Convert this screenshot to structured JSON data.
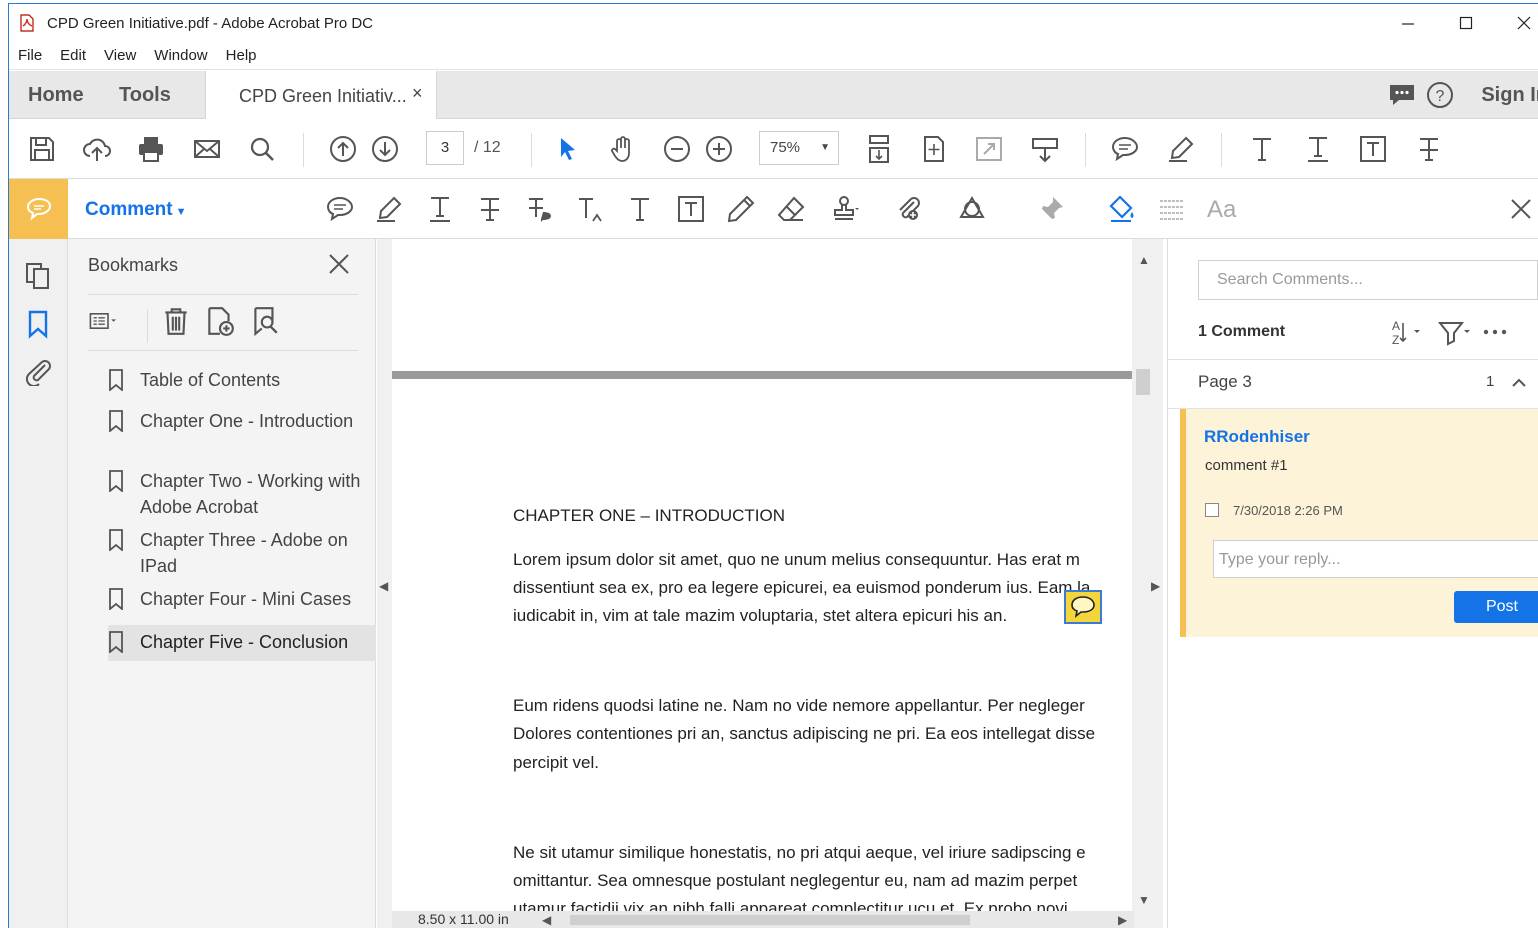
{
  "window": {
    "title": "CPD Green Initiative.pdf - Adobe Acrobat Pro DC",
    "accent_color": "#2b79d0"
  },
  "menu": [
    "File",
    "Edit",
    "View",
    "Window",
    "Help"
  ],
  "tabs": {
    "home": "Home",
    "tools": "Tools",
    "document": "CPD Green Initiativ...",
    "close_glyph": "×",
    "sign_in": "Sign In"
  },
  "toolbar": {
    "page_current": "3",
    "page_total": "/ 12",
    "zoom": "75%"
  },
  "comment_toolbar": {
    "label": "Comment",
    "font_label": "Aa",
    "accent_color": "#f5c051"
  },
  "bookmarks": {
    "title": "Bookmarks",
    "items": [
      {
        "label": "Table of Contents",
        "selected": false
      },
      {
        "label": "Chapter One - Introduction",
        "selected": false
      },
      {
        "label": "Chapter Two - Working with Adobe Acrobat",
        "selected": false
      },
      {
        "label": "Chapter Three - Adobe on IPad",
        "selected": false
      },
      {
        "label": "Chapter Four - Mini Cases",
        "selected": false
      },
      {
        "label": "Chapter Five - Conclusion",
        "selected": true
      }
    ]
  },
  "document": {
    "heading": "CHAPTER ONE – INTRODUCTION",
    "paragraph1": [
      "Lorem ipsum dolor sit amet, quo ne unum melius consequuntur. Has erat m",
      "dissentiunt sea ex, pro ea legere epicurei, ea euismod ponderum ius. Eam la",
      "iudicabit in, vim at tale mazim voluptaria, stet altera epicuri his an."
    ],
    "paragraph2": [
      "Eum ridens quodsi latine ne. Nam no vide nemore appellantur. Per negleger",
      "Dolores contentiones pri an, sanctus adipiscing ne pri. Ea eos intellegat disse",
      "percipit vel."
    ],
    "paragraph3": [
      "Ne sit utamur similique honestatis, no pri atqui aeque, vel iriure sadipscing e",
      "omittantur. Sea omnesque postulant neglegentur eu, nam ad mazim perpet",
      "utamur factidii vix an nibh falli appareat complectitur ucu et. Ex probo novi"
    ],
    "page_size": "8.50 x 11.00 in"
  },
  "comments": {
    "search_placeholder": "Search Comments...",
    "count_label": "1 Comment",
    "page_label": "Page 3",
    "page_count": "1",
    "items": [
      {
        "author": "RRodenhiser",
        "text": "comment #1",
        "date": "7/30/2018  2:26 PM",
        "reply_placeholder": "Type your reply...",
        "post_label": "Post"
      }
    ]
  }
}
